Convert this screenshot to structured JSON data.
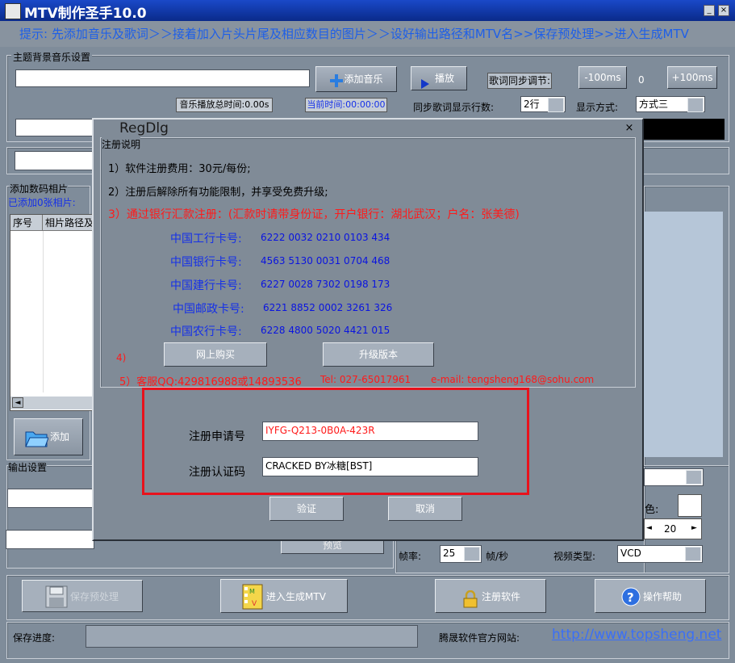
{
  "window": {
    "title": "MTV制作圣手10.0",
    "min": "_",
    "close": "×"
  },
  "hint": "提示: 先添加音乐及歌词＞＞接着加入片头片尾及相应数目的图片＞＞设好输出路径和MTV名>>保存预处理>>进入生成MTV",
  "music": {
    "section": "主题背景音乐设置",
    "add_music": "添加音乐",
    "play": "播放",
    "lyric_sync": "歌词同步调节:",
    "minus": "-100ms",
    "offset": "0",
    "plus": "+100ms",
    "total_time": "音乐播放总时间:0.00s",
    "current_time": "当前时间:00:00:00",
    "sync_lines_label": "同步歌词显示行数:",
    "sync_lines_value": "2行",
    "display_mode_label": "显示方式:",
    "display_mode_value": "方式三"
  },
  "photos": {
    "section": "添加数码相片",
    "added": "已添加0张相片:",
    "col_index": "序号",
    "col_path": "相片路径及",
    "add": "添加"
  },
  "output": {
    "section": "输出设置",
    "color_label": "色:",
    "spin_value": "20",
    "fps_label": "帧率:",
    "fps_value": "25",
    "fps_unit": "帧/秒",
    "video_type_label": "视频类型:",
    "video_type_value": "VCD",
    "partial_button": "预览"
  },
  "bottom": {
    "save_preprocess": "保存预处理",
    "enter_generate": "进入生成MTV",
    "register": "注册软件",
    "help": "操作帮助",
    "progress_label": "保存进度:",
    "site_label": "腾晟软件官方网站:",
    "site_url": "http://www.topsheng.net"
  },
  "dialog": {
    "title": "RegDlg",
    "close": "×",
    "group": "注册说明",
    "line1": "1）软件注册费用：30元/每份;",
    "line2": "2）注册后解除所有功能限制，并享受免费升级;",
    "line3": "3）通过银行汇款注册：(汇款时请带身份证，开户银行：湖北武汉；户名：张美德)",
    "banks": [
      {
        "name": "中国工行卡号:",
        "number": "6222 0032 0210 0103 434"
      },
      {
        "name": "中国银行卡号:",
        "number": "4563  5130  0031  0704  468"
      },
      {
        "name": "中国建行卡号:",
        "number": "6227 0028 7302 0198 173"
      },
      {
        "name": "中国邮政卡号:",
        "number": "6221 8852 0002 3261 326"
      },
      {
        "name": "中国农行卡号:",
        "number": "6228  4800  5020  4421  015"
      }
    ],
    "item4": "4)",
    "buy_online": "网上购买",
    "upgrade": "升级版本",
    "item5": "5）客服QQ:429816988或14893536",
    "tel": "Tel: 027-65017961",
    "email": "e-mail: tengsheng168@sohu.com",
    "apply_label": "注册申请号",
    "apply_value": "IYFG-Q213-0B0A-423R",
    "auth_label": "注册认证码",
    "auth_value": "CRACKED BY冰糖[BST]",
    "verify": "验证",
    "cancel": "取消"
  }
}
